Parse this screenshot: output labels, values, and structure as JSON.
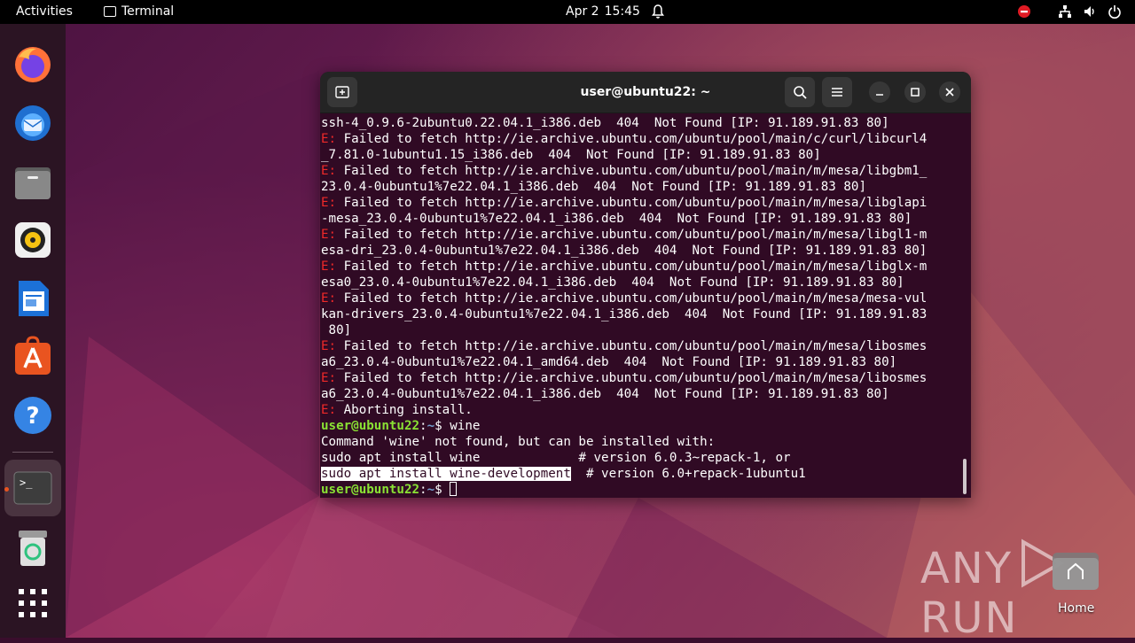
{
  "topbar": {
    "activities": "Activities",
    "app_name": "Terminal",
    "date": "Apr 2",
    "time": "15:45"
  },
  "dock": {
    "items": [
      "Firefox",
      "Thunderbird",
      "Files",
      "Rhythmbox",
      "LibreOffice Writer",
      "Ubuntu Software",
      "Help",
      "Terminal",
      "Trash",
      "Show Applications"
    ],
    "active": "Terminal"
  },
  "terminal": {
    "title": "user@ubuntu22: ~",
    "lines": [
      {
        "type": "text",
        "text": "ssh-4_0.9.6-2ubuntu0.22.04.1_i386.deb  404  Not Found [IP: 91.189.91.83 80]"
      },
      {
        "type": "error",
        "prefix": "E:",
        "text": " Failed to fetch http://ie.archive.ubuntu.com/ubuntu/pool/main/c/curl/libcurl4"
      },
      {
        "type": "text",
        "text": "_7.81.0-1ubuntu1.15_i386.deb  404  Not Found [IP: 91.189.91.83 80]"
      },
      {
        "type": "error",
        "prefix": "E:",
        "text": " Failed to fetch http://ie.archive.ubuntu.com/ubuntu/pool/main/m/mesa/libgbm1_"
      },
      {
        "type": "text",
        "text": "23.0.4-0ubuntu1%7e22.04.1_i386.deb  404  Not Found [IP: 91.189.91.83 80]"
      },
      {
        "type": "error",
        "prefix": "E:",
        "text": " Failed to fetch http://ie.archive.ubuntu.com/ubuntu/pool/main/m/mesa/libglapi"
      },
      {
        "type": "text",
        "text": "-mesa_23.0.4-0ubuntu1%7e22.04.1_i386.deb  404  Not Found [IP: 91.189.91.83 80]"
      },
      {
        "type": "error",
        "prefix": "E:",
        "text": " Failed to fetch http://ie.archive.ubuntu.com/ubuntu/pool/main/m/mesa/libgl1-m"
      },
      {
        "type": "text",
        "text": "esa-dri_23.0.4-0ubuntu1%7e22.04.1_i386.deb  404  Not Found [IP: 91.189.91.83 80]"
      },
      {
        "type": "error",
        "prefix": "E:",
        "text": " Failed to fetch http://ie.archive.ubuntu.com/ubuntu/pool/main/m/mesa/libglx-m"
      },
      {
        "type": "text",
        "text": "esa0_23.0.4-0ubuntu1%7e22.04.1_i386.deb  404  Not Found [IP: 91.189.91.83 80]"
      },
      {
        "type": "error",
        "prefix": "E:",
        "text": " Failed to fetch http://ie.archive.ubuntu.com/ubuntu/pool/main/m/mesa/mesa-vul"
      },
      {
        "type": "text",
        "text": "kan-drivers_23.0.4-0ubuntu1%7e22.04.1_i386.deb  404  Not Found [IP: 91.189.91.83"
      },
      {
        "type": "text",
        "text": " 80]"
      },
      {
        "type": "error",
        "prefix": "E:",
        "text": " Failed to fetch http://ie.archive.ubuntu.com/ubuntu/pool/main/m/mesa/libosmes"
      },
      {
        "type": "text",
        "text": "a6_23.0.4-0ubuntu1%7e22.04.1_amd64.deb  404  Not Found [IP: 91.189.91.83 80]"
      },
      {
        "type": "error",
        "prefix": "E:",
        "text": " Failed to fetch http://ie.archive.ubuntu.com/ubuntu/pool/main/m/mesa/libosmes"
      },
      {
        "type": "text",
        "text": "a6_23.0.4-0ubuntu1%7e22.04.1_i386.deb  404  Not Found [IP: 91.189.91.83 80]"
      },
      {
        "type": "error",
        "prefix": "E:",
        "text": " Aborting install."
      },
      {
        "type": "prompt",
        "user": "user@ubuntu22",
        "sep": ":",
        "path": "~",
        "symbol": "$ ",
        "cmd": "wine"
      },
      {
        "type": "text",
        "text": "Command 'wine' not found, but can be installed with:"
      },
      {
        "type": "text",
        "text": "sudo apt install wine             # version 6.0.3~repack-1, or"
      },
      {
        "type": "selected",
        "sel": "sudo apt install wine-development",
        "rest": "  # version 6.0+repack-1ubuntu1"
      },
      {
        "type": "prompt_cursor",
        "user": "user@ubuntu22",
        "sep": ":",
        "path": "~",
        "symbol": "$ ",
        "cmd": ""
      }
    ]
  },
  "watermark": {
    "text_left": "ANY",
    "text_right": "RUN"
  },
  "desktop": {
    "home_label": "Home"
  },
  "colors": {
    "terminal_bg": "#300a24",
    "error_red": "#ef2929",
    "prompt_green": "#8ae234",
    "path_blue": "#729fcf",
    "ubuntu_orange": "#e95420"
  }
}
